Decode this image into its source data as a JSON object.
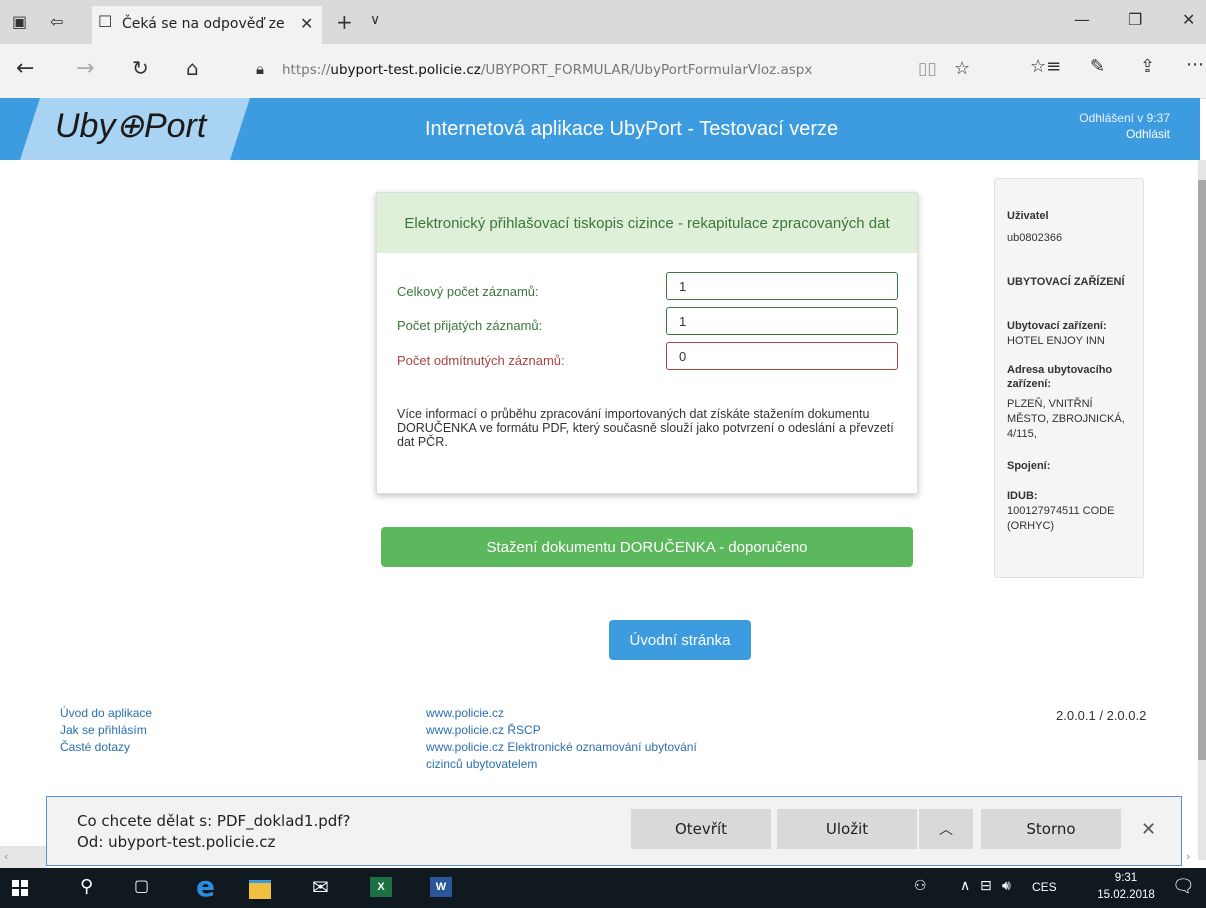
{
  "browser": {
    "tab_title": "Čeká se na odpověď ze",
    "url_prefix": "https://",
    "url_domain": "ubyport-test.policie.cz",
    "url_path": "/UBYPORT_FORMULAR/UbyPortFormularVloz.aspx"
  },
  "app": {
    "logo": "Uby⊕Port",
    "title": "Internetová aplikace UbyPort - Testovací verze",
    "logout_timer": "Odhlášení v 9:37",
    "logout_link": "Odhlásit"
  },
  "panel": {
    "heading": "Elektronický přihlašovací tiskopis cizince - rekapitulace zpracovaných dat",
    "rows": [
      {
        "label": "Celkový počet záznamů:",
        "value": "1"
      },
      {
        "label": "Počet přijatých záznamů:",
        "value": "1"
      },
      {
        "label": "Počet odmítnutých záznamů:",
        "value": "0"
      }
    ],
    "info": "Více informací o průběhu zpracování importovaných dat získáte stažením dokumentu DORUČENKA ve formátu PDF, který současně slouží jako potvrzení o odeslání a převzetí dat PČR."
  },
  "buttons": {
    "download": "Stažení dokumentu DORUČENKA - doporučeno",
    "home": "Úvodní stránka"
  },
  "sidebar": {
    "user_label": "Uživatel",
    "user_value": "ub0802366",
    "facility_heading": "UBYTOVACÍ ZAŘÍZENÍ",
    "facility_label": "Ubytovací zařízení:",
    "facility_value": "HOTEL ENJOY INN",
    "address_label": "Adresa ubytovacího zařízení:",
    "address_value": "PLZEŇ, VNITŘNÍ MĚSTO, ZBROJNICKÁ, 4/115,",
    "contact_label": "Spojení:",
    "idub_label": "IDUB:",
    "idub_value": "100127974511 CODE (ORHYC)"
  },
  "footer": {
    "left_links": [
      "Úvod do aplikace",
      "Jak se přihlásím",
      "Časté dotazy"
    ],
    "mid_links": [
      "www.policie.cz",
      "www.policie.cz ŘSCP",
      "www.policie.cz Elektronické oznamování ubytování",
      "cizinců ubytovatelem"
    ],
    "version": "2.0.0.1 / 2.0.0.2"
  },
  "download_bar": {
    "question": "Co chcete dělat s: PDF_doklad1.pdf?",
    "source": "Od: ubyport-test.policie.cz",
    "open": "Otevřít",
    "save": "Uložit",
    "cancel": "Storno"
  },
  "taskbar": {
    "lang": "CES",
    "time": "9:31",
    "date": "15.02.2018"
  },
  "colors": {
    "header_blue": "#3d9ce0",
    "success_green": "#5cb85c",
    "panel_head_bg": "#dff0d8",
    "error_red": "#a94442"
  }
}
